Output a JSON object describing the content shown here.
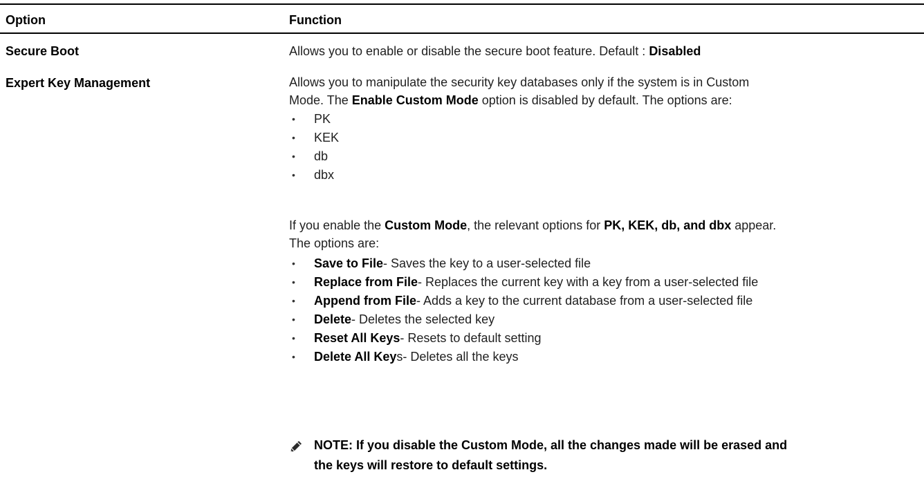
{
  "header": {
    "option": "Option",
    "function": "Function"
  },
  "rows": [
    {
      "option": "Secure Boot",
      "function_text": "Allows you to enable or disable the secure boot feature. Default : ",
      "function_bold": "Disabled"
    },
    {
      "option": "Expert Key Management",
      "intro_line1": "Allows you to manipulate the security key databases only if the system is in Custom",
      "intro_line2_pre": "Mode. The ",
      "intro_line2_bold": "Enable Custom Mode",
      "intro_line2_post": " option is disabled by default. The options are:",
      "key_list": [
        "PK",
        "KEK",
        "db",
        "dbx"
      ],
      "custom_line1_pre": "If you enable the ",
      "custom_line1_bold1": "Custom Mode",
      "custom_line1_mid": ", the relevant options for ",
      "custom_line1_bold2": "PK, KEK, db, and dbx",
      "custom_line1_post": " appear.",
      "custom_line2": "The options are:",
      "options": [
        {
          "bold": "Save to File",
          "text": "- Saves the key to a user-selected file"
        },
        {
          "bold": "Replace from File",
          "text": "- Replaces the current key with a key from a user-selected file"
        },
        {
          "bold": "Append from File",
          "text": "- Adds a key to the current database from a user-selected file"
        },
        {
          "bold": "Delete",
          "text": "- Deletes the selected key"
        },
        {
          "bold": "Reset All Keys",
          "text": "- Resets to default setting"
        },
        {
          "bold": "Delete All Key",
          "text": "s- Deletes all the keys"
        }
      ],
      "note_line1": "NOTE: If you disable the Custom Mode, all the changes made will be erased and",
      "note_line2": "the keys will restore to default settings."
    }
  ],
  "icons": {
    "note_icon": "pencil-icon"
  }
}
